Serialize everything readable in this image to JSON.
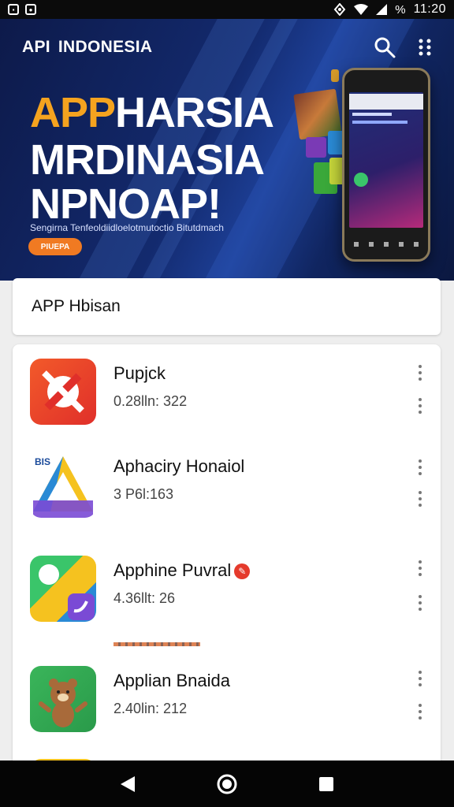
{
  "status_bar": {
    "time": "11:20",
    "battery_text": "%"
  },
  "header": {
    "logo_text": "API",
    "title": "INDONESIA",
    "search_icon": "search-icon",
    "menu_icon": "more-vert-icon"
  },
  "banner": {
    "hero_accent": "APP",
    "hero_line1_rest": "HARSIA",
    "hero_line2": "MRDINASIA",
    "hero_line3": "NPNOAP!",
    "subtitle": "Sengirna Tenfeoldiidloelotmutoctio Bitutdmach",
    "button_label": "PIUEPA"
  },
  "search": {
    "label": "APP Hbisan"
  },
  "apps": [
    {
      "name": "Pupjck",
      "meta": "0.28lln: 322",
      "icon": "tools-icon",
      "badge": ""
    },
    {
      "name": "Aphaciry Honaiol",
      "meta": "3 P6l:163",
      "icon": "triangle-app-icon",
      "icon_text": "BIS",
      "badge": ""
    },
    {
      "name": "Apphine Puvral",
      "meta": "4.36llt: 26",
      "icon": "chat-app-icon",
      "badge": "✎"
    },
    {
      "name": "Applian Bnaida",
      "meta": "2.40lin: 212",
      "icon": "bear-app-icon",
      "badge": ""
    }
  ],
  "nav": {
    "back_icon": "back-icon",
    "home_icon": "home-icon",
    "recents_icon": "recents-icon"
  },
  "colors": {
    "banner_bg": "#132a6e",
    "accent_orange": "#f5a31f",
    "button_orange": "#f07a22"
  }
}
